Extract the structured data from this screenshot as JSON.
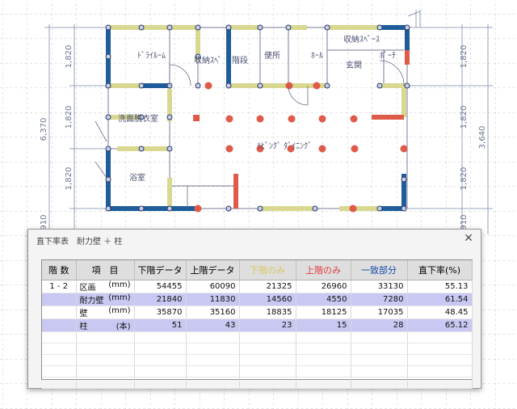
{
  "drawing": {
    "dimensions_left": [
      "6,370",
      "1,820",
      "1,820",
      "1,820",
      "910"
    ],
    "dimensions_right": [
      "1,820",
      "1,820",
      "3,640",
      "1,820",
      "910"
    ],
    "rooms": {
      "dry_room": "ﾄﾞﾗｲﾙｰﾑ",
      "storage1": "収納ｽﾍﾟ",
      "stairs": "階段",
      "toilet": "便所",
      "hall": "ﾎｰﾙ",
      "storage2": "収納ｽﾍﾟｰｽ",
      "entrance": "玄関",
      "porch": "ﾎﾟｰﾁ",
      "dressing": "洗面脱衣室",
      "living": "ﾘﾋﾞﾝｸﾞ ﾀﾞｲﾆﾝｸﾞ",
      "bath": "浴室"
    }
  },
  "dialog": {
    "title": "直下率表　耐力壁 ＋ 柱",
    "close": "✕",
    "headers": {
      "floor": "階 数",
      "item": "項　目",
      "lower": "下階データ",
      "upper": "上階データ",
      "lower_only": "下階のみ",
      "upper_only": "上階のみ",
      "match": "一致部分",
      "ratio": "直下率(%)"
    },
    "header_colors": {
      "lower_only": "#d8c860",
      "upper_only": "#e04040",
      "match": "#1a4aa8"
    },
    "rows": [
      {
        "floor": "1 - 2",
        "item": "区画",
        "unit": "(mm)",
        "lower": "54455",
        "upper": "60090",
        "lower_only": "21325",
        "upper_only": "26960",
        "match": "33130",
        "ratio": "55.13"
      },
      {
        "floor": "",
        "item": "耐力壁",
        "unit": "(mm)",
        "lower": "21840",
        "upper": "11830",
        "lower_only": "14560",
        "upper_only": "4550",
        "match": "7280",
        "ratio": "61.54"
      },
      {
        "floor": "",
        "item": "壁",
        "unit": "(mm)",
        "lower": "35870",
        "upper": "35160",
        "lower_only": "18835",
        "upper_only": "18125",
        "match": "17035",
        "ratio": "48.45"
      },
      {
        "floor": "",
        "item": "柱",
        "unit": "(本)",
        "lower": "51",
        "upper": "43",
        "lower_only": "23",
        "upper_only": "15",
        "match": "28",
        "ratio": "65.12"
      }
    ]
  }
}
